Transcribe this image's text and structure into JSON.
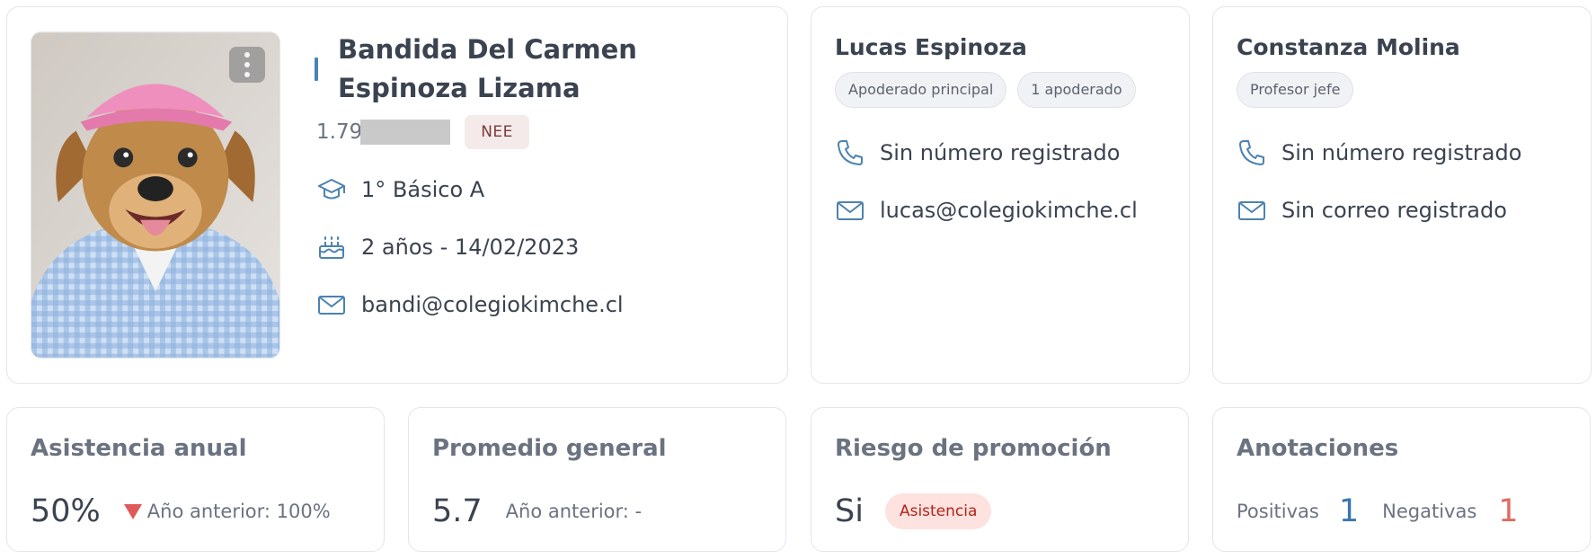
{
  "student": {
    "name": "Bandida Del Carmen Espinoza Lizama",
    "rut_prefix": "1.79",
    "badge": "NEE",
    "course": "1° Básico A",
    "age_birth": "2 años - 14/02/2023",
    "email": "bandi@colegiokimche.cl",
    "photo_alt": "student-photo"
  },
  "guardian": {
    "name": "Lucas Espinoza",
    "chips": [
      "Apoderado principal",
      "1 apoderado"
    ],
    "phone": "Sin número registrado",
    "email": "lucas@colegiokimche.cl"
  },
  "teacher": {
    "name": "Constanza Molina",
    "chips": [
      "Profesor jefe"
    ],
    "phone": "Sin número registrado",
    "email": "Sin correo registrado"
  },
  "stats": {
    "attendance": {
      "title": "Asistencia anual",
      "value": "50%",
      "previous": "Año anterior: 100%"
    },
    "average": {
      "title": "Promedio general",
      "value": "5.7",
      "previous": "Año anterior: -"
    },
    "risk": {
      "title": "Riesgo de promoción",
      "value": "Si",
      "badge": "Asistencia"
    },
    "annotations": {
      "title": "Anotaciones",
      "positive_label": "Positivas",
      "positive": "1",
      "negative_label": "Negativas",
      "negative": "1"
    }
  },
  "colors": {
    "accent": "#4c82b0",
    "icon": "#4c82b0",
    "negative": "#e06b5f",
    "positive": "#3a76b0"
  }
}
